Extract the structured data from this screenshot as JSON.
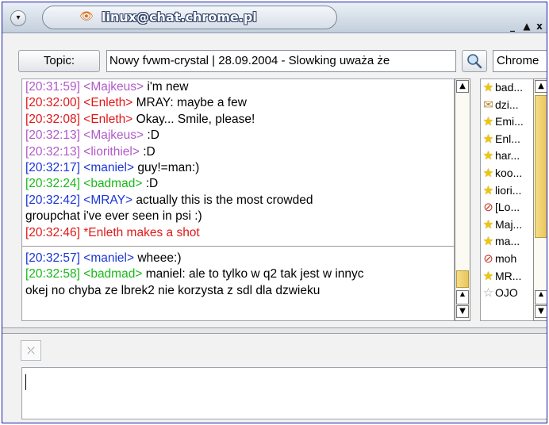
{
  "window": {
    "title": "linux@chat.chrome.pl",
    "buttons": {
      "menu": "▾",
      "minimize": "_",
      "maximize": "▲",
      "close": "x"
    }
  },
  "topic": {
    "button_label": "Topic:",
    "text": "Nowy fvwm-crystal | 28.09.2004 - Slowking uważa że",
    "nick_field": "Chrome"
  },
  "log": {
    "before_separator": [
      {
        "time": "[20:31:59]",
        "nick": "<Majkeus>",
        "text": "i'm new",
        "color": "purple"
      },
      {
        "time": "[20:32:00]",
        "nick": "<Enleth>",
        "text": "MRAY: maybe a few",
        "color": "red"
      },
      {
        "time": "[20:32:08]",
        "nick": "<Enleth>",
        "text": "Okay... Smile, please!",
        "color": "red"
      },
      {
        "time": "[20:32:13]",
        "nick": "<Majkeus>",
        "text": ":D",
        "color": "purple"
      },
      {
        "time": "[20:32:13]",
        "nick": "<liorithiel>",
        "text": ":D",
        "color": "purple"
      },
      {
        "time": "[20:32:17]",
        "nick": "<maniel>",
        "text": "guy!=man:)",
        "color": "blue"
      },
      {
        "time": "[20:32:24]",
        "nick": "<badmad>",
        "text": ":D",
        "color": "green"
      },
      {
        "time": "[20:32:42]",
        "nick": "<MRAY>",
        "text": "actually this is the most crowded",
        "continuation": "groupchat i've ever seen in psi :)",
        "color": "blue"
      },
      {
        "time": "[20:32:46]",
        "nick": "*Enleth makes a shot",
        "text": "",
        "color": "red"
      }
    ],
    "after_separator": [
      {
        "time": "[20:32:57]",
        "nick": "<maniel>",
        "text": "wheee:)",
        "color": "blue"
      },
      {
        "time": "[20:32:58]",
        "nick": "<badmad>",
        "text": "maniel: ale to tylko w q2 tak jest w innyc",
        "continuation": "okej no chyba ze lbrek2 nie korzysta z sdl dla dzwieku",
        "color": "green"
      }
    ]
  },
  "roster": [
    {
      "name": "bad...",
      "status": "star"
    },
    {
      "name": "dzi...",
      "status": "away"
    },
    {
      "name": "Emi...",
      "status": "star"
    },
    {
      "name": "Enl...",
      "status": "star"
    },
    {
      "name": "har...",
      "status": "star"
    },
    {
      "name": "koo...",
      "status": "star"
    },
    {
      "name": "liori...",
      "status": "star"
    },
    {
      "name": "[Lo...",
      "status": "busy"
    },
    {
      "name": "Maj...",
      "status": "star"
    },
    {
      "name": "ma...",
      "status": "star"
    },
    {
      "name": "moh",
      "status": "busy"
    },
    {
      "name": "MR...",
      "status": "star"
    },
    {
      "name": "OJO",
      "status": "grey"
    }
  ],
  "icons": {
    "star": "★",
    "away": "✉",
    "busy": "⊘",
    "grey": "☆",
    "eye": "👁",
    "clear": "⤫",
    "up": "▲",
    "down": "▼",
    "both": "▲▼"
  },
  "input": {
    "value": ""
  }
}
